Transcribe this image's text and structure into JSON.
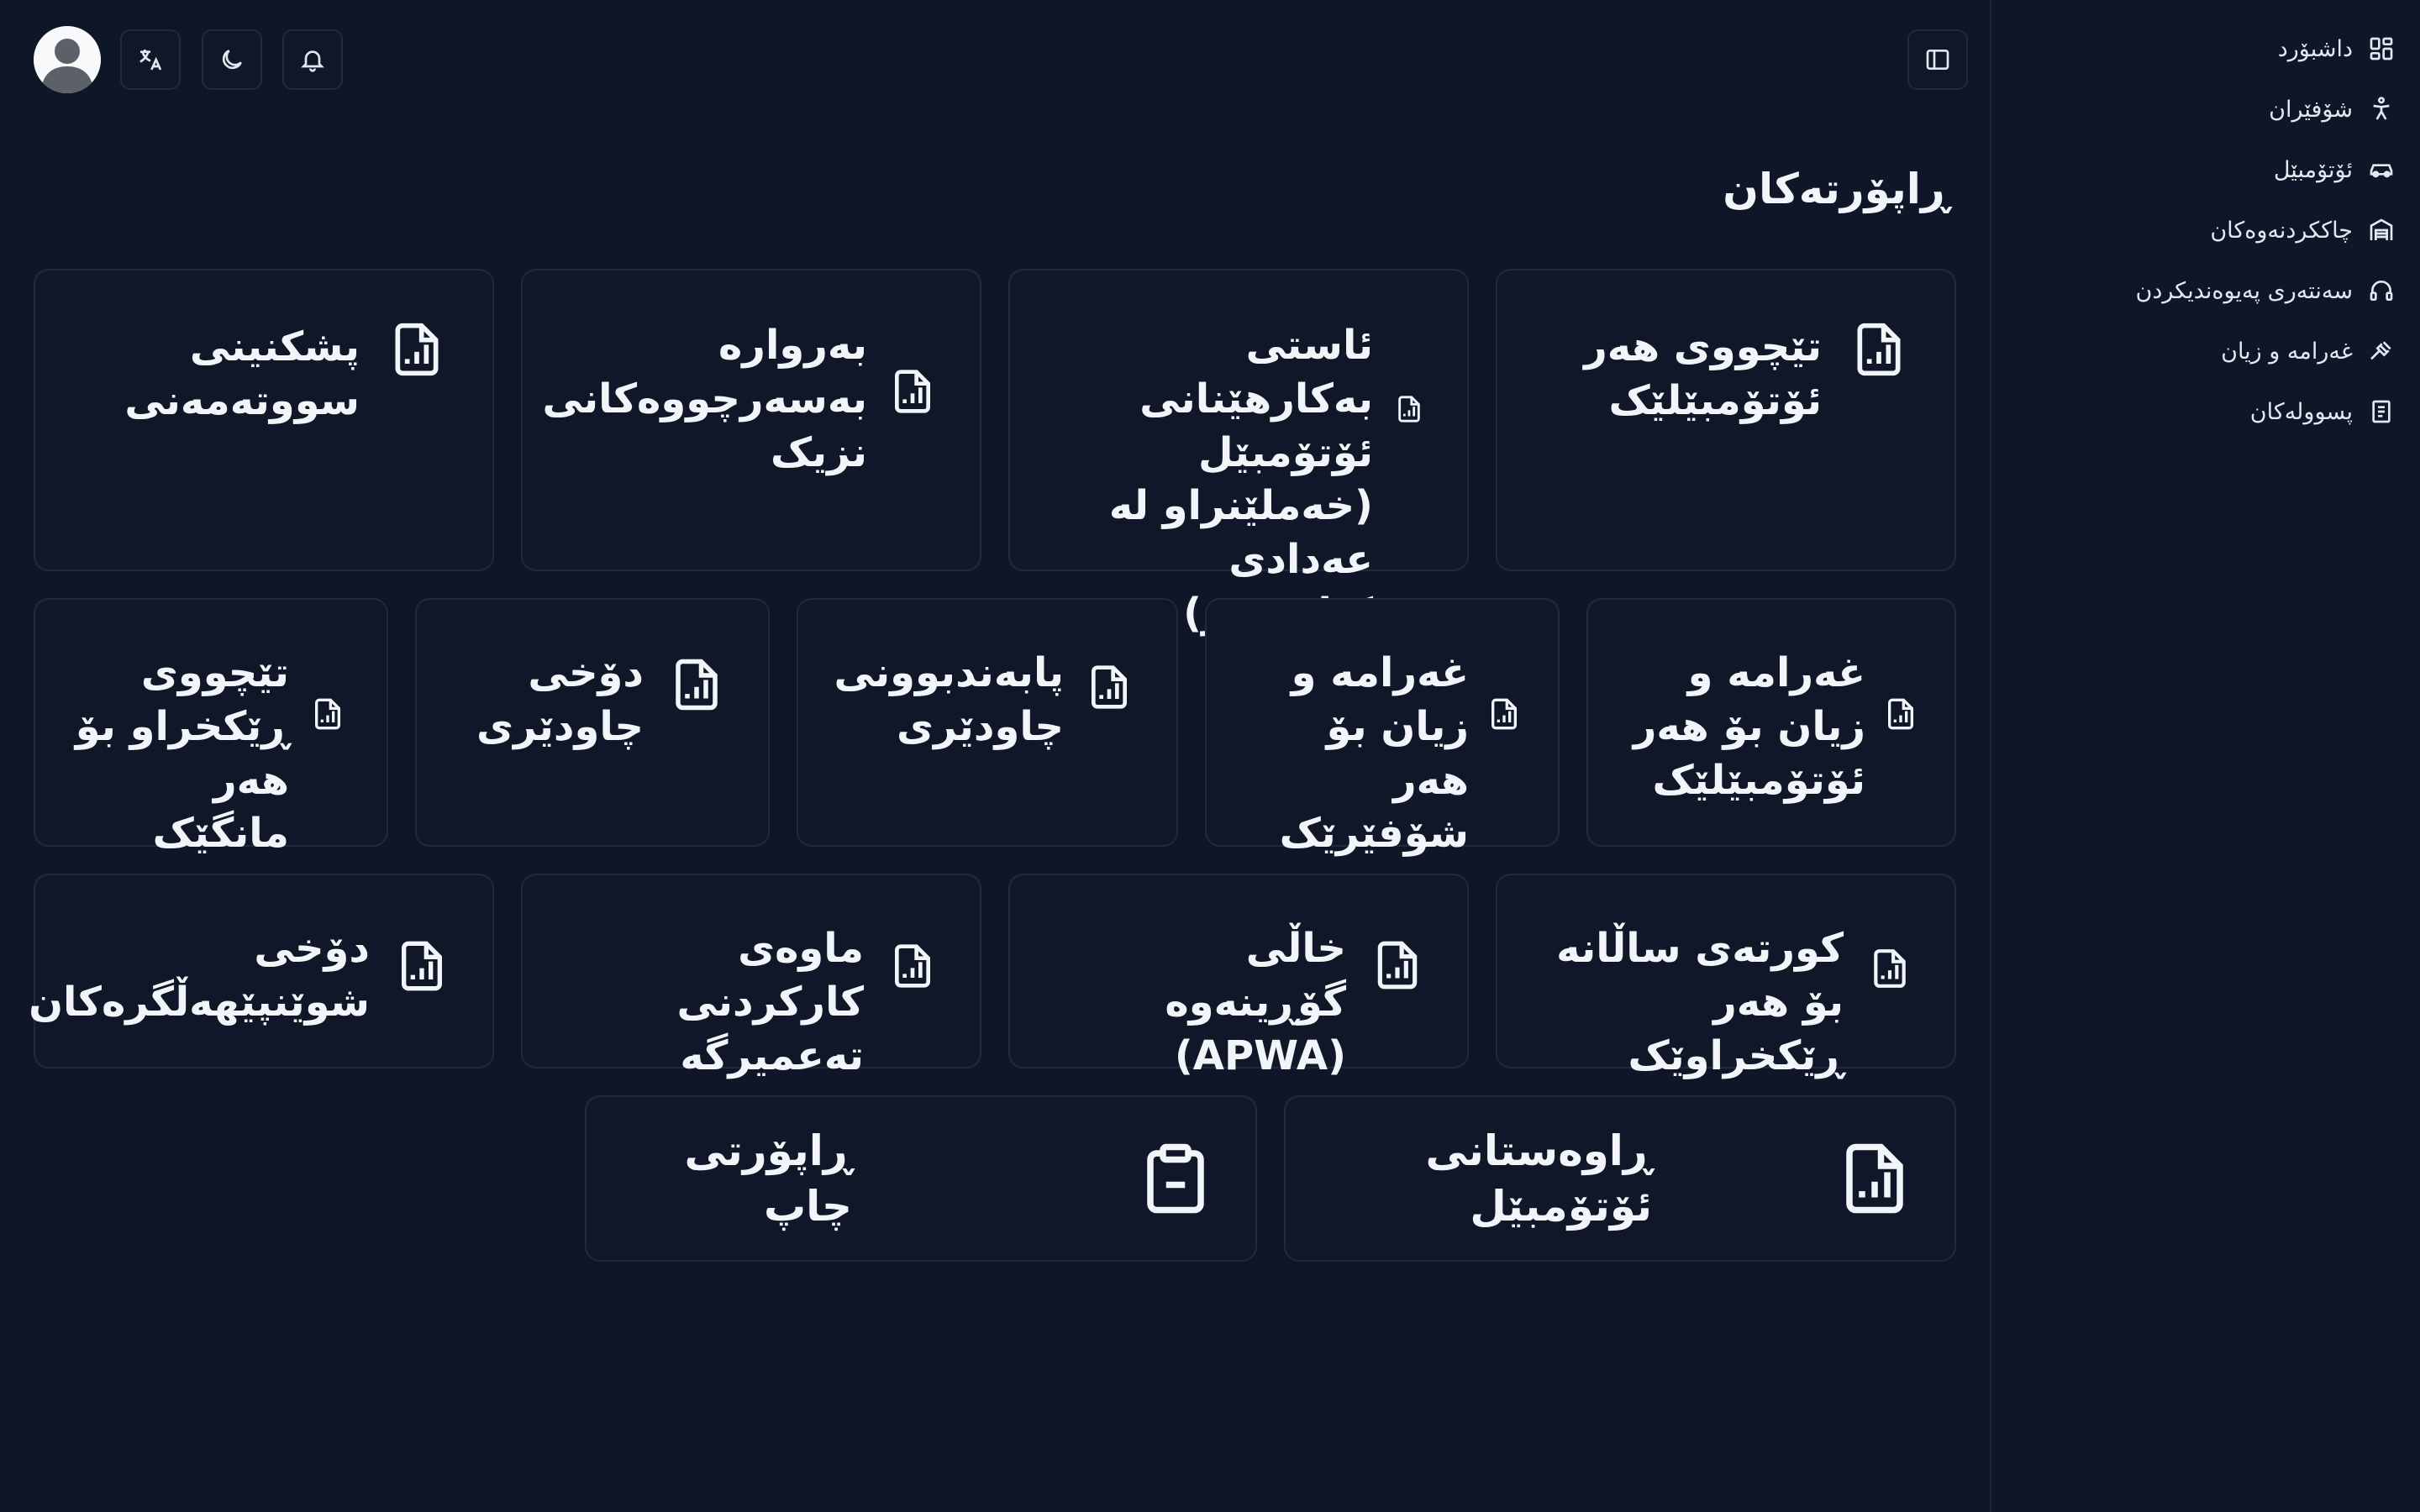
{
  "sidebar": {
    "items": [
      {
        "label": "داشبۆرد",
        "icon": "dashboard-icon"
      },
      {
        "label": "شۆفێران",
        "icon": "person-icon"
      },
      {
        "label": "ئۆتۆمبێل",
        "icon": "car-icon"
      },
      {
        "label": "چاککردنەوەکان",
        "icon": "garage-icon"
      },
      {
        "label": "سەنتەری پەیوەندیکردن",
        "icon": "headset-icon"
      },
      {
        "label": "غەرامە و زیان",
        "icon": "gavel-icon"
      },
      {
        "label": "پسوولەکان",
        "icon": "receipt-icon"
      }
    ]
  },
  "header": {
    "title": "ڕاپۆرتەکان"
  },
  "reports": {
    "row1": [
      "تێچووی هەر ئۆتۆمبێلێک",
      "ئاستی بەکارهێنانی ئۆتۆمبێل (خەملێنراو لە عەدادی کیلۆمەتر)",
      "بەروارە بەسەرچووەکانی نزیک",
      "پشکنینی سووتەمەنی"
    ],
    "row2": [
      "غەرامە و زیان بۆ هەر ئۆتۆمبێلێک",
      "غەرامە و زیان بۆ هەر شۆفێرێک",
      "پابەندبوونی چاودێری",
      "دۆخی چاودێری",
      "تێچووی ڕێکخراو بۆ هەر مانگێک"
    ],
    "row3": [
      "کورتەی ساڵانە بۆ هەر ڕێکخراوێک",
      "خاڵی گۆڕینەوە (APWA)",
      "ماوەی کارکردنی تەعمیرگە",
      "دۆخی شوێنپێهەڵگرەکان"
    ],
    "big": [
      "ڕاوەستانی ئۆتۆمبێل",
      "ڕاپۆرتی چاپ"
    ]
  }
}
